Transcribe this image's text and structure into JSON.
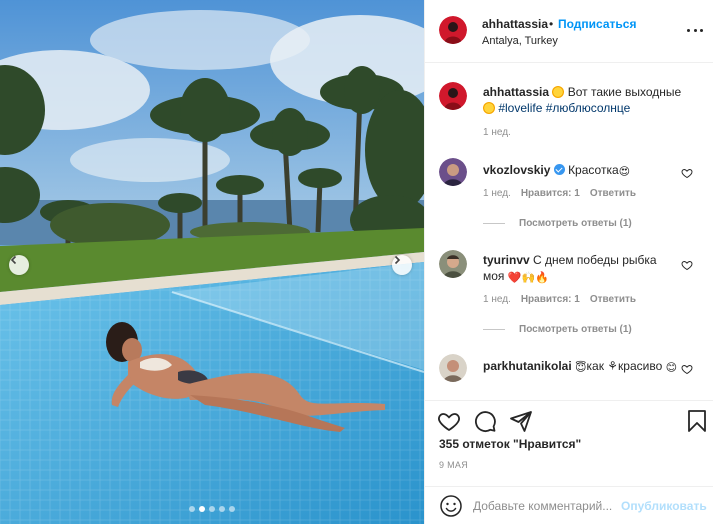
{
  "header": {
    "username": "ahhattassia",
    "separator": "•",
    "follow_label": "Подписаться",
    "location": "Antalya, Turkey"
  },
  "caption": {
    "username": "ahhattassia",
    "text_1": "Вот такие выходные",
    "hashtag_1": "#lovelife",
    "hashtag_2": "#люблюсолнце",
    "time": "1 нед."
  },
  "comments": [
    {
      "username": "vkozlovskiy",
      "verified": true,
      "text": "Красотка",
      "emoji": "😍",
      "time": "1 нед.",
      "likes": "Нравится: 1",
      "reply_label": "Ответить",
      "view_replies": "Посмотреть ответы (1)"
    },
    {
      "username": "tyurinvv",
      "text": "С днем победы рыбка моя",
      "emoji": "❤️🙌🔥",
      "time": "1 нед.",
      "likes": "Нравится: 1",
      "reply_label": "Ответить",
      "view_replies": "Посмотреть ответы (1)"
    },
    {
      "username": "parkhutanikolai",
      "emoji_pre": "😇",
      "text": "как ⚘красиво",
      "emoji": "😊"
    }
  ],
  "actions": {
    "likes_text": "355 отметок \"Нравится\"",
    "date": "9 МАЯ"
  },
  "add_comment": {
    "placeholder": "Добавьте комментарий...",
    "post_label": "Опубликовать"
  },
  "carousel": {
    "dots": 5,
    "active_dot": 1
  },
  "colors": {
    "link": "#0095f6",
    "hashtag": "#00376b",
    "muted": "#8e8e8e",
    "pool": "#3fa3d6"
  },
  "icons": [
    "more-icon",
    "heart-icon",
    "comment-icon",
    "share-icon",
    "bookmark-icon",
    "smile-icon",
    "chevron-left-icon",
    "chevron-right-icon",
    "verified-icon"
  ]
}
